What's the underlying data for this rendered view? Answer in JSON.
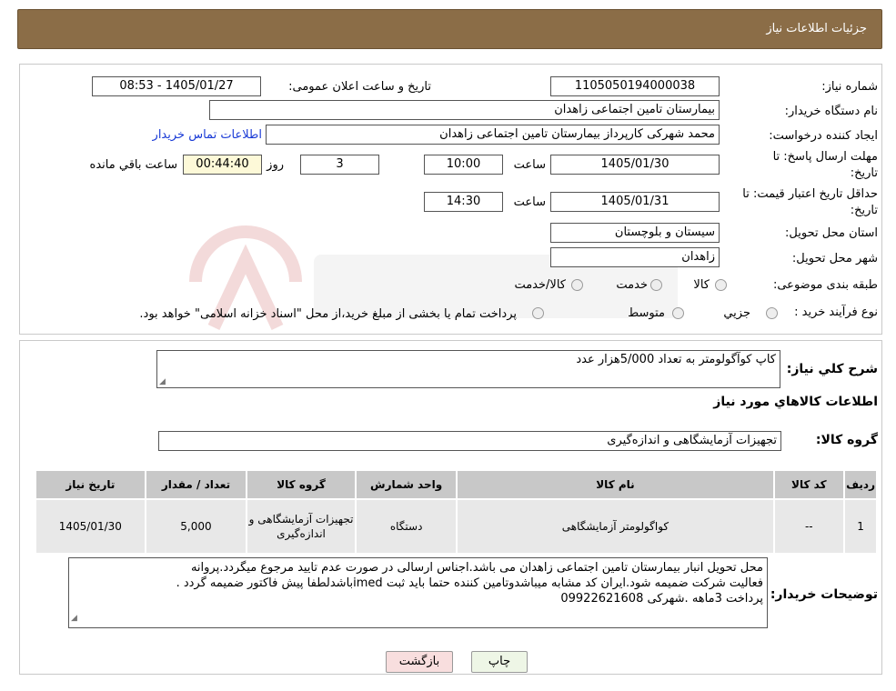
{
  "header": {
    "title": "جزئیات اطلاعات نیاز"
  },
  "form": {
    "need_number": {
      "label": "شماره نیاز:",
      "value": "1105050194000038"
    },
    "announce_datetime": {
      "label": "تاریخ و ساعت اعلان عمومی:",
      "value": "1405/01/27 - 08:53"
    },
    "buyer_org": {
      "label": "نام دستگاه خریدار:",
      "value": "بیمارستان تامین اجتماعی زاهدان"
    },
    "requester": {
      "label": "ایجاد کننده درخواست:",
      "value": "محمد شهرکی کارپرداز بیمارستان تامین اجتماعی زاهدان"
    },
    "contact_link": "اطلاعات تماس خریدار",
    "deadline": {
      "label": "مهلت ارسال پاسخ: تا تاریخ:",
      "date": "1405/01/30",
      "time_label": "ساعت",
      "time": "10:00",
      "days": "3",
      "days_label": "روز و",
      "remaining": "00:44:40",
      "remaining_label": "ساعت باقي مانده"
    },
    "price_validity": {
      "label": "حداقل تاریخ اعتبار قیمت: تا تاریخ:",
      "date": "1405/01/31",
      "time_label": "ساعت",
      "time": "14:30"
    },
    "province": {
      "label": "استان محل تحویل:",
      "value": "سیستان و بلوچستان"
    },
    "city": {
      "label": "شهر محل تحویل:",
      "value": "زاهدان"
    },
    "category": {
      "label": "طبقه بندی موضوعی:",
      "options": [
        "کالا",
        "خدمت",
        "کالا/خدمت"
      ]
    },
    "purchase_type": {
      "label": "نوع فرآیند خرید :",
      "options": [
        "جزیي",
        "متوسط"
      ],
      "note": "پرداخت تمام یا بخشی از مبلغ خرید،از محل \"اسناد خزانه اسلامی\" خواهد بود."
    }
  },
  "description": {
    "label": "شرح کلي نياز:",
    "value": "کاپ کوآگولومتر به تعداد 5/000هزار عدد"
  },
  "goods_section_title": "اطلاعات کالاهاي مورد نياز",
  "goods_group": {
    "label": "گروه کالا:",
    "value": "تجهیزات آزمایشگاهی و اندازه‌گیری"
  },
  "table": {
    "headers": [
      "رديف",
      "کد کالا",
      "نام کالا",
      "واحد شمارش",
      "گروه کالا",
      "تعداد / مقدار",
      "تاریخ نیاز"
    ],
    "rows": [
      [
        "1",
        "--",
        "کواگولومتر آزمایشگاهی",
        "دستگاه",
        "تجهیزات آزمایشگاهی و اندازه‌گیری",
        "5,000",
        "1405/01/30"
      ]
    ]
  },
  "buyer_notes": {
    "label": "توضیحات خریدار:",
    "lines": [
      "محل تحویل انبار بیمارستان تامین اجتماعی زاهدان می باشد.اجناس ارسالی در صورت عدم تایید مرجوع میگردد.پروانه",
      "فعالیت شرکت ضمیمه شود.ایران کد مشابه میباشدوتامین کننده حتما باید ثبت imedباشدلطفا پیش فاکتور ضمیمه گردد .",
      "پرداخت 3ماهه  .شهرکی 09922621608"
    ]
  },
  "buttons": {
    "print": "چاپ",
    "back": "بازگشت"
  },
  "colors": {
    "header_bg": "#8b6d47",
    "link": "#1a3bd6",
    "table_header": "#c8c8c8",
    "table_cell": "#e8e8e8"
  }
}
